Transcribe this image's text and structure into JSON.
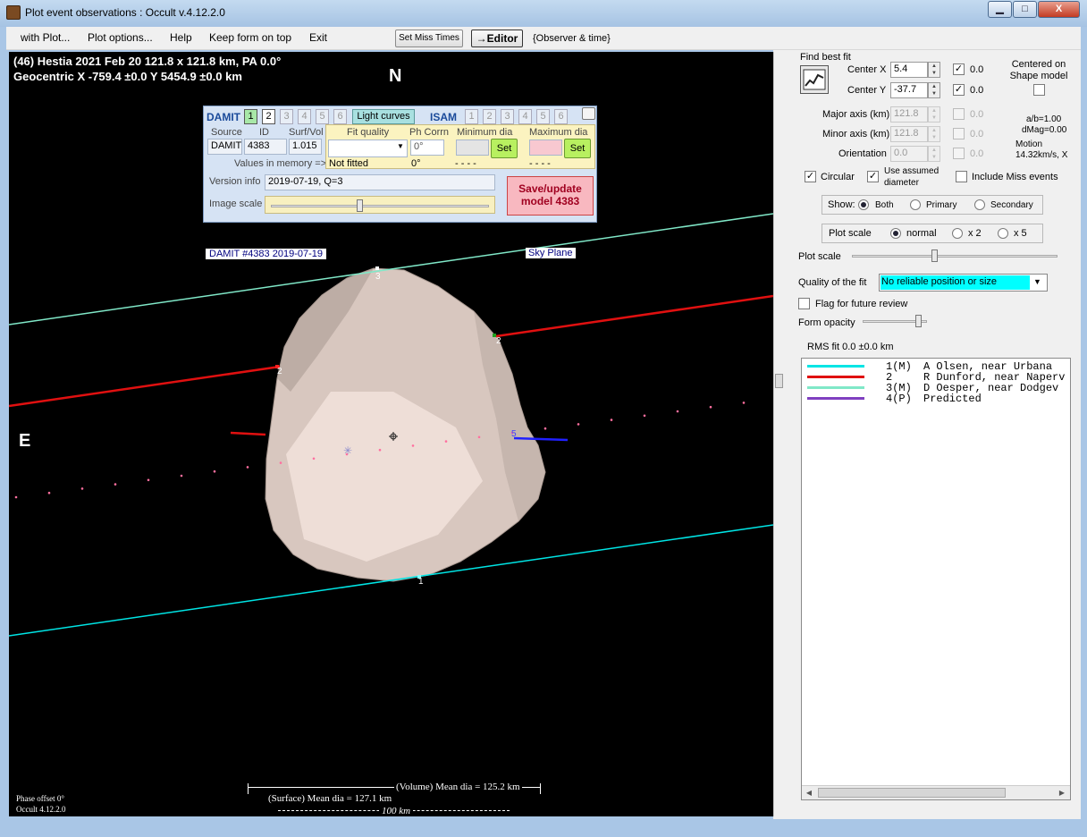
{
  "window": {
    "title": "Plot event observations : Occult v.4.12.2.0",
    "minimize": "▁",
    "maximize": "□",
    "close": "X"
  },
  "menu": {
    "with_plot": "with Plot...",
    "plot_options": "Plot options...",
    "help": "Help",
    "keep_on_top": "Keep form on top",
    "exit": "Exit"
  },
  "toolbar": {
    "set_miss_times": "Set Miss Times",
    "editor": "→Editor",
    "observer_time": "{Observer & time}"
  },
  "plot": {
    "header_line1": "(46) Hestia  2021 Feb 20   121.8 x 121.8 km, PA 0.0°",
    "header_line2": "Geocentric  X  -759.4 ±0.0  Y 5454.9 ±0.0 km",
    "north": "N",
    "east": "E",
    "model_label": "DAMIT #4383 2019-07-19",
    "sky_plane": "Sky Plane",
    "chord_labels": [
      "1",
      "2",
      "2",
      "3",
      "5"
    ],
    "volume_mean": "(Volume) Mean dia = 125.2 km",
    "surface_mean": "(Surface) Mean dia = 127.1 km",
    "scale_bar": "100 km",
    "phase_offset": "Phase offset 0°",
    "version": "Occult 4.12.2.0"
  },
  "damit": {
    "damit_label": "DAMIT",
    "isam_label": "ISAM",
    "tabs": [
      "1",
      "2",
      "3",
      "4",
      "5",
      "6"
    ],
    "light_curves": "Light curves",
    "source_header": "Source",
    "id_header": "ID",
    "surfvol_header": "Surf/Vol",
    "source": "DAMIT",
    "id": "4383",
    "surf_vol": "1.015",
    "values_in_memory": "Values in memory =>",
    "fit_quality_header": "Fit quality",
    "ph_corr_header": "Ph Corrn",
    "min_dia_header": "Minimum dia",
    "max_dia_header": "Maximum dia",
    "fit_quality": "",
    "ph_corr": "0°",
    "fit_quality_value": "Not fitted",
    "ph_corr_value": "0°",
    "min_dia_value": "- - - -",
    "max_dia_value": "- - - -",
    "set": "Set",
    "version_label": "Version info",
    "version_value": "2019-07-19, Q=3",
    "image_scale_label": "Image scale",
    "image_scale_level": 0.42,
    "save_button": "Save/update model 4383"
  },
  "panel": {
    "find_best_fit": "Find best fit",
    "center_x_label": "Center X",
    "center_x": "5.4",
    "center_x_check": "0.0",
    "center_y_label": "Center Y",
    "center_y": "-37.7",
    "center_y_check": "0.0",
    "centered_on": "Centered on Shape model",
    "major_axis_label": "Major axis (km)",
    "major_axis": "121.8",
    "major_check": "0.0",
    "minor_axis_label": "Minor axis (km)",
    "minor_axis": "121.8",
    "minor_check": "0.0",
    "orientation_label": "Orientation",
    "orientation": "0.0",
    "orient_check": "0.0",
    "ab": "a/b=1.00",
    "dmag": "dMag=0.00",
    "motion_label": "Motion",
    "motion": "14.32km/s, X",
    "circular": "Circular",
    "use_assumed": "Use assumed diameter",
    "include_miss": "Include Miss events",
    "show_label": "Show:",
    "show_both": "Both",
    "show_primary": "Primary",
    "show_secondary": "Secondary",
    "plot_scale_group": "Plot scale",
    "scale_normal": "normal",
    "scale_x2": "x 2",
    "scale_x5": "x 5",
    "plot_scale_label": "Plot scale",
    "plot_scale_level": 0.4,
    "quality_label": "Quality of the fit",
    "quality_value": "No reliable position or size",
    "flag_review": "Flag for future review",
    "form_opacity": "Form opacity",
    "form_opacity_level": 0.9,
    "rms_fit": "RMS fit 0.0 ±0.0 km",
    "observers": [
      {
        "num": "1(M)",
        "name": "A Olsen, near Urbana",
        "color": "#00e5e5"
      },
      {
        "num": "2",
        "name": "R Dunford, near Naperv",
        "color": "#e01010"
      },
      {
        "num": "3(M)",
        "name": "D Oesper, near Dodgev",
        "color": "#80e8c8"
      },
      {
        "num": "4(P)",
        "name": "Predicted",
        "color": "#8040c0"
      }
    ]
  }
}
